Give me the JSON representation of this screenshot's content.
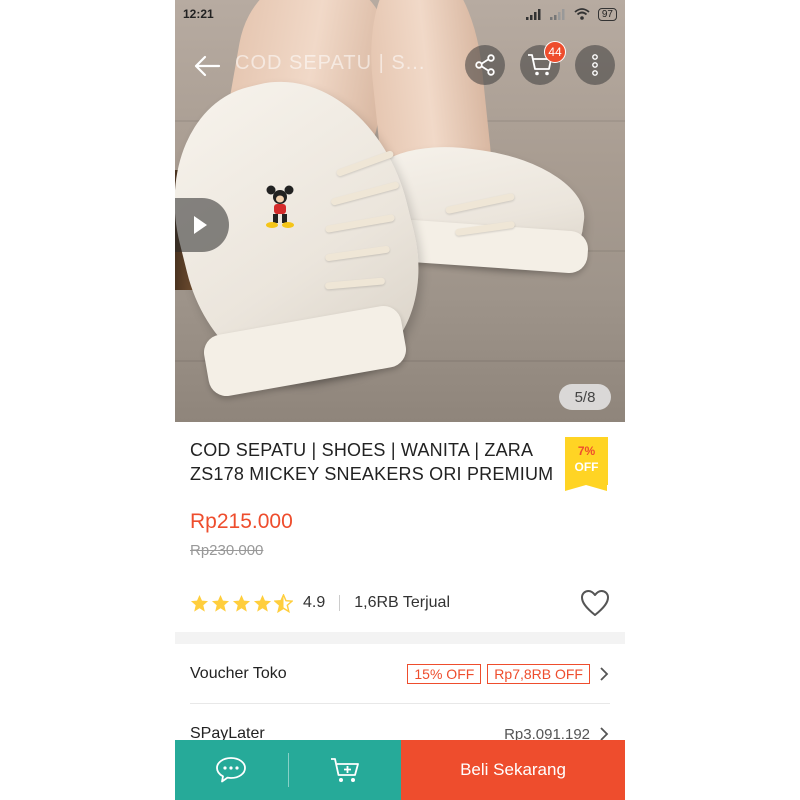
{
  "status_bar": {
    "time": "12:21",
    "battery": "97"
  },
  "header": {
    "ghost_title": "COD SEPATU | S...",
    "cart_count": "44"
  },
  "gallery": {
    "counter": "5/8"
  },
  "product": {
    "title": "COD SEPATU | SHOES | WANITA | ZARA ZS178 MICKEY SNEAKERS ORI PREMIUM",
    "discount_percent": "7%",
    "discount_label": "OFF",
    "price": "Rp215.000",
    "original_price": "Rp230.000",
    "rating": "4.9",
    "rating_stars": 4.5,
    "sold": "1,6RB Terjual"
  },
  "rows": {
    "voucher_label": "Voucher Toko",
    "voucher_1": "15% OFF",
    "voucher_2": "Rp7,8RB OFF",
    "paylater_label": "SPayLater",
    "paylater_value": "Rp3.091.192"
  },
  "bottom_bar": {
    "buy_label": "Beli Sekarang"
  },
  "colors": {
    "accent": "#ee4d2d",
    "teal": "#26aa99",
    "star": "#ffce3d",
    "tag": "#ffd424"
  }
}
